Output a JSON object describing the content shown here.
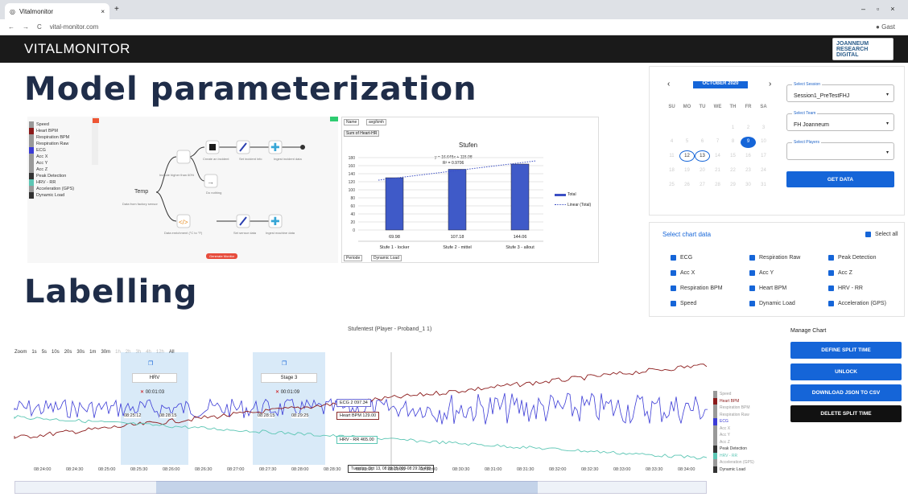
{
  "browser": {
    "tab_title": "Vitalmonitor",
    "url": "vital-monitor.com",
    "profile": "Gast"
  },
  "app": {
    "brand": "VITALMONITOR",
    "logo": "JOANNEUM RESEARCH DIGITAL"
  },
  "headings": {
    "model": "Model parameterization",
    "labelling": "Labelling"
  },
  "legend": [
    "Speed",
    "Heart BPM",
    "Respiration BPM",
    "Respiration Raw",
    "ECG",
    "Acc X",
    "Acc Y",
    "Acc Z",
    "Peak Detection",
    "HRV - RR",
    "Acceleration (GPS)",
    "Dynamic Load"
  ],
  "flow": {
    "temp": "Temp",
    "from_sensor": "Data from factory sensor",
    "include": "Include higher than 60%",
    "create_incident": "Create an incident",
    "set_incident": "Set incident info",
    "ingest_incident": "Ingest incident data",
    "do_nothing": "Do nothing",
    "enrichment": "Data enrichment (°C to °F)",
    "set_sensor": "Set sensor data",
    "ingest_machine": "Ingest machine data",
    "generate": "Generate Monitor"
  },
  "stufen": {
    "title": "Stufen",
    "equation": "y = 16.645x + 115.08",
    "r2": "R² = 0.9706",
    "filters": [
      "Name",
      "avg/kmh"
    ],
    "sum_label": "Sum of Heart-HR",
    "legend_total": "Total",
    "legend_linear": "Linear (Total)",
    "bottom_filters": [
      "Periode",
      "Dynamic Load"
    ]
  },
  "chart_data": {
    "type": "bar",
    "title": "Stufen",
    "categories": [
      "Stufe 1 - locker",
      "Stufe 2 - mittel",
      "Stufe 3 - allout"
    ],
    "values": [
      129.98,
      151.0,
      164.0
    ],
    "labels": [
      "69.98",
      "107.18",
      "144.06"
    ],
    "ylim": [
      0,
      180
    ],
    "yticks": [
      0,
      20,
      40,
      60,
      80,
      100,
      120,
      140,
      160,
      180
    ]
  },
  "calendar": {
    "month": "OCTOBER 2020",
    "days": [
      "SU",
      "MO",
      "TU",
      "WE",
      "TH",
      "FR",
      "SA"
    ],
    "rows": [
      [
        "",
        "",
        "",
        "",
        "1",
        "2",
        "3"
      ],
      [
        "4",
        "5",
        "6",
        "7",
        "8",
        "9",
        "10"
      ],
      [
        "11",
        "12",
        "13",
        "14",
        "15",
        "16",
        "17"
      ],
      [
        "18",
        "19",
        "20",
        "21",
        "22",
        "23",
        "24"
      ],
      [
        "25",
        "26",
        "27",
        "28",
        "29",
        "30",
        "31"
      ]
    ]
  },
  "selects": {
    "session_label": "Select Session",
    "session": "Session1_PreTestFHJ",
    "team_label": "Select Team",
    "team": "FH Joanneum",
    "players_label": "Select Players",
    "players": ""
  },
  "get_data": "GET DATA",
  "chart_select": {
    "title": "Select chart data",
    "select_all": "Select all",
    "items": [
      "ECG",
      "Respiration Raw",
      "Peak Detection",
      "Acc X",
      "Acc Y",
      "Acc Z",
      "Respiration BPM",
      "Heart BPM",
      "HRV - RR",
      "Speed",
      "Dynamic Load",
      "Acceleration (GPS)"
    ]
  },
  "stock": {
    "title": "Stufentest (Player - Proband_1 1)",
    "zoom_label": "Zoom",
    "zoom": [
      "1s",
      "5s",
      "10s",
      "20s",
      "30s",
      "1m",
      "30m",
      "1h",
      "2h",
      "3h",
      "4h",
      "12h",
      "All"
    ],
    "band1": "HRV",
    "band1_time": "00:01:03",
    "band1_start": "08:25:12",
    "band1_end": "08:28:15",
    "band2": "Stage 3",
    "band2_time": "00:01:09",
    "band2_start": "08:28:15",
    "band2_end": "08:29:25",
    "ecg": "ECG 2 097.34",
    "hr": "Heart BPM 129.00",
    "hrv": "HRV - RR 465.00",
    "tooltip": "Tuesday, Oct 13, 08:29:25.000-08:29:25.499",
    "times": [
      "08:24:00",
      "08:24:30",
      "08:25:00",
      "08:25:30",
      "08:26:00",
      "08:26:30",
      "08:27:00",
      "08:27:30",
      "08:28:00",
      "08:28:30",
      "08:29:00",
      "08:29:30",
      "08:30:00",
      "08:30:30",
      "08:31:00",
      "08:31:30",
      "08:32:00",
      "08:32:30",
      "08:33:00",
      "08:33:30",
      "08:34:00"
    ]
  },
  "manage": {
    "title": "Manage Chart",
    "define": "DEFINE SPLIT TIME",
    "unlock": "UNLOCK",
    "download": "DOWNLOAD JSON TO CSV",
    "delete": "DELETE SPLIT TIME"
  }
}
